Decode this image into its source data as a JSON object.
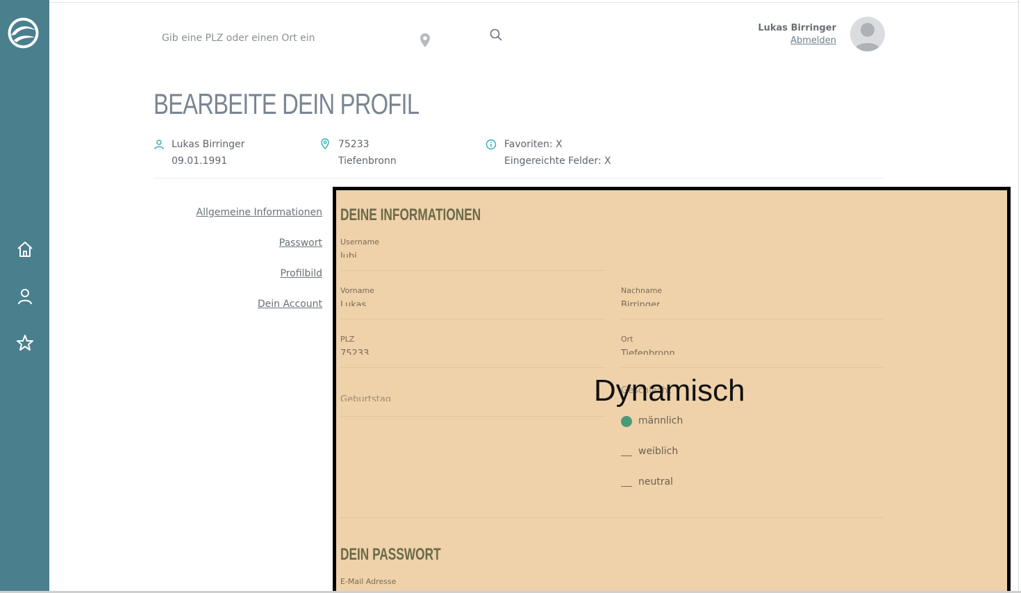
{
  "header": {
    "search_placeholder": "Gib eine PLZ oder einen Ort ein",
    "user_name": "Lukas Birringer",
    "logout_label": "Abmelden"
  },
  "sidebar": {
    "items": [
      {
        "icon": "home-icon"
      },
      {
        "icon": "user-icon"
      },
      {
        "icon": "star-icon"
      }
    ]
  },
  "page": {
    "title": "BEARBEITE DEIN PROFIL",
    "info": {
      "name": "Lukas Birringer",
      "birthday": "09.01.1991",
      "zip": "75233",
      "city": "Tiefenbronn",
      "favorites": "Favoriten: X",
      "submitted": "Eingereichte Felder: X"
    }
  },
  "side_nav": {
    "general": "Allgemeine Informationen",
    "password": "Passwort",
    "picture": "Profilbild",
    "account": "Dein Account"
  },
  "form": {
    "section_info": "DEINE INFORMATIONEN",
    "username_label": "Username",
    "username_value": "lubi",
    "firstname_label": "Vorname",
    "firstname_value": "Lukas",
    "lastname_label": "Nachname",
    "lastname_value": "Birringer",
    "zip_label": "PLZ",
    "zip_value": "75233",
    "city_label": "Ort",
    "city_value": "Tiefenbronn",
    "birthday_placeholder": "Geburtstag",
    "gender_label": "Geschlecht",
    "overlay_text": "Dynamisch",
    "gender_options": [
      "männlich",
      "weiblich",
      "neutral"
    ],
    "gender_selected": "männlich",
    "section_password": "DEIN PASSWORT",
    "email_label": "E-Mail Adresse"
  },
  "colors": {
    "sidebar": "#4a7f8e",
    "panel": "#efd2aa",
    "accent_icon": "#2ab0b8",
    "selected_radio": "#4a9a78"
  }
}
